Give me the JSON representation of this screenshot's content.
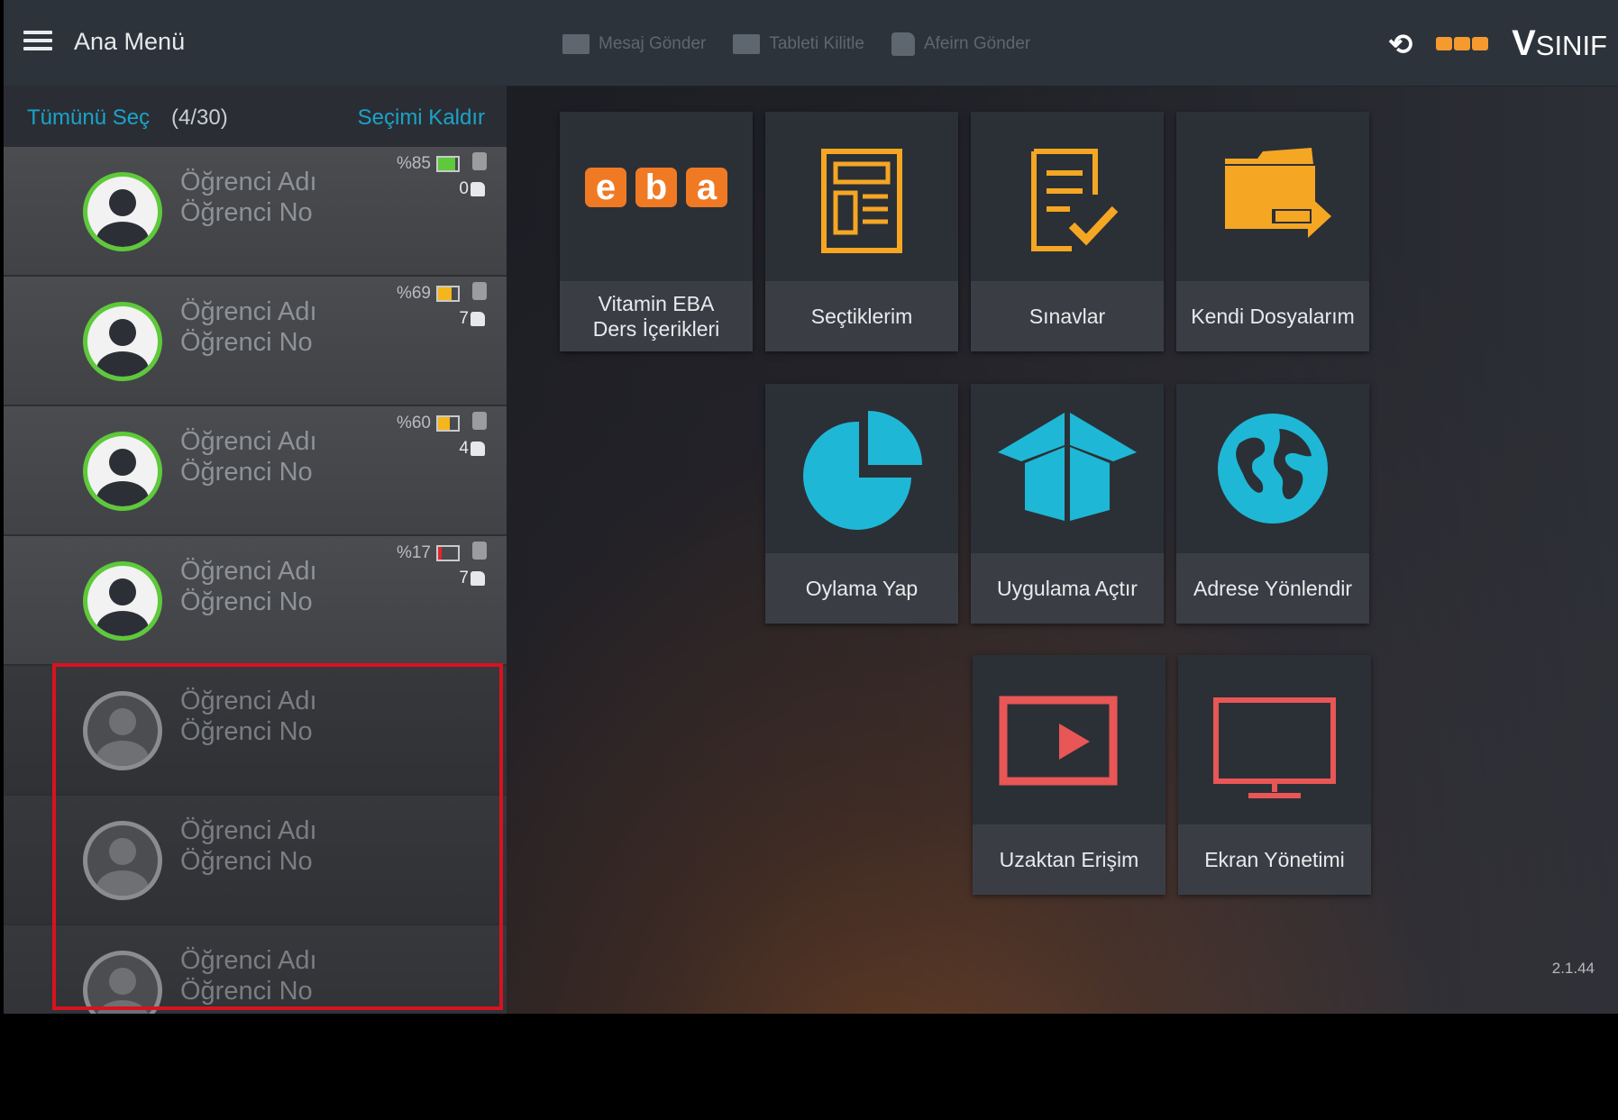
{
  "topbar": {
    "menu_title": "Ana Menü",
    "actions": [
      {
        "label": "Mesaj Gönder",
        "icon": "mail-icon"
      },
      {
        "label": "Tableti Kilitle",
        "icon": "tablet-lock-icon"
      },
      {
        "label": "Afeirn Gönder",
        "icon": "thumb-up-icon"
      }
    ],
    "history_glyph": "⟲",
    "brand": "SINIF",
    "brand_mark": "V"
  },
  "sidebar": {
    "select_all": "Tümünü Seç",
    "count": "(4/30)",
    "clear_selection": "Seçimi Kaldır",
    "students": [
      {
        "name": "Öğrenci Adı",
        "no": "Öğrenci No",
        "battery": "%85",
        "battery_level": 0.85,
        "battery_color": "#5ec93a",
        "likes": "0",
        "online": true
      },
      {
        "name": "Öğrenci Adı",
        "no": "Öğrenci No",
        "battery": "%69",
        "battery_level": 0.69,
        "battery_color": "#f5b51c",
        "likes": "7",
        "online": true
      },
      {
        "name": "Öğrenci Adı",
        "no": "Öğrenci No",
        "battery": "%60",
        "battery_level": 0.6,
        "battery_color": "#f5b51c",
        "likes": "4",
        "online": true
      },
      {
        "name": "Öğrenci Adı",
        "no": "Öğrenci No",
        "battery": "%17",
        "battery_level": 0.17,
        "battery_color": "#e3262b",
        "likes": "7",
        "online": true
      },
      {
        "name": "Öğrenci Adı",
        "no": "Öğrenci No",
        "online": false
      },
      {
        "name": "Öğrenci Adı",
        "no": "Öğrenci No",
        "online": false
      },
      {
        "name": "Öğrenci Adı",
        "no": "Öğrenci No",
        "online": false
      }
    ]
  },
  "tiles": {
    "eba": {
      "label": "Vitamin EBA\nDers İçerikleri",
      "icon": "eba-logo-icon",
      "logo_text": "eba"
    },
    "secimler": {
      "label": "Seçtiklerim",
      "icon": "document-layout-icon"
    },
    "sinavlar": {
      "label": "Sınavlar",
      "icon": "exam-check-icon"
    },
    "dosyalar": {
      "label": "Kendi Dosyalarım",
      "icon": "folder-share-icon"
    },
    "oylama": {
      "label": "Oylama Yap",
      "icon": "pie-chart-icon"
    },
    "uygulama": {
      "label": "Uygulama Açtır",
      "icon": "open-box-icon"
    },
    "adres": {
      "label": "Adrese Yönlendir",
      "icon": "globe-icon"
    },
    "uzaktan": {
      "label": "Uzaktan Erişim",
      "icon": "play-screen-icon"
    },
    "ekran": {
      "label": "Ekran Yönetimi",
      "icon": "monitor-icon"
    }
  },
  "colors": {
    "accent": "#1aa3c9",
    "orange": "#f5a623",
    "cyan": "#1eb8d6",
    "red": "#e85656"
  },
  "version": "2.1.44"
}
